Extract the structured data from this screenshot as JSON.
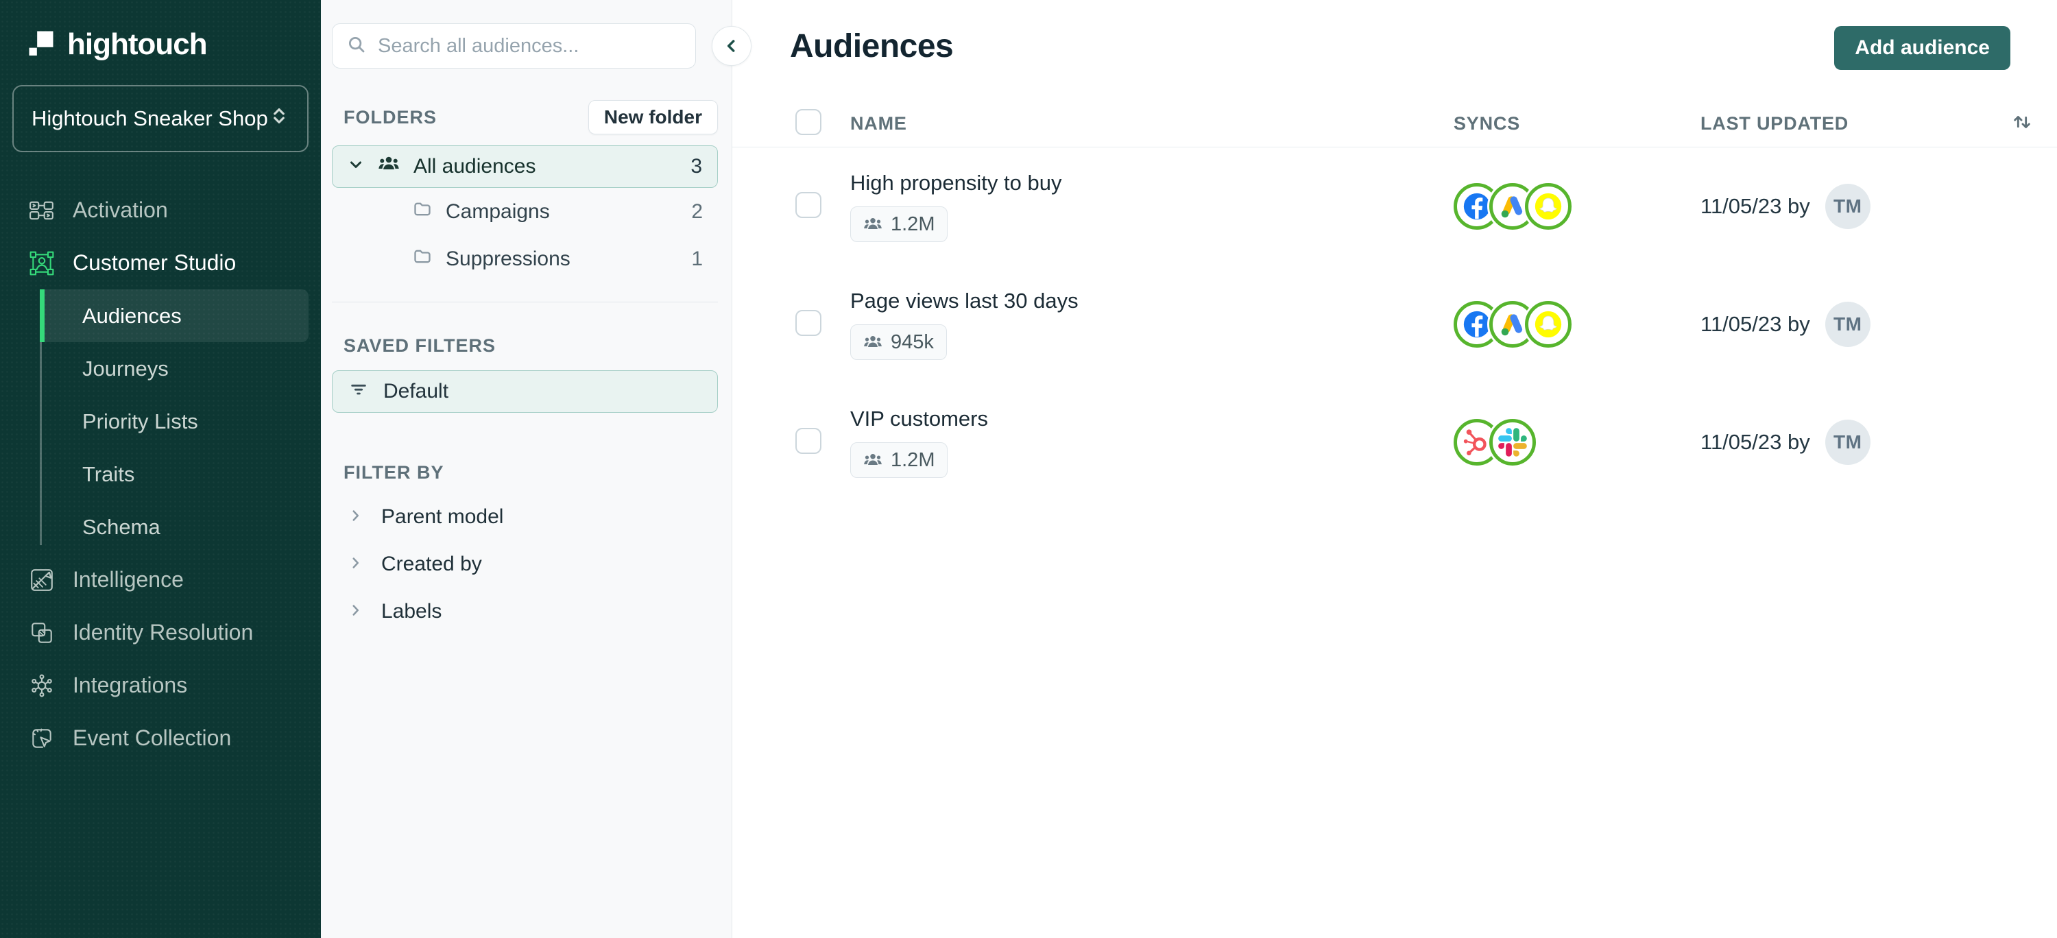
{
  "brand": {
    "logo_text": "hightouch",
    "workspace_name": "Hightouch Sneaker Shop"
  },
  "sidebar": {
    "items": [
      {
        "label": "Activation",
        "icon": "activation-icon"
      },
      {
        "label": "Customer Studio",
        "icon": "customer-studio-icon",
        "active": true,
        "children": [
          {
            "label": "Audiences",
            "active": true
          },
          {
            "label": "Journeys"
          },
          {
            "label": "Priority Lists"
          },
          {
            "label": "Traits"
          },
          {
            "label": "Schema"
          }
        ]
      },
      {
        "label": "Intelligence",
        "icon": "intelligence-icon"
      },
      {
        "label": "Identity Resolution",
        "icon": "identity-resolution-icon"
      },
      {
        "label": "Integrations",
        "icon": "integrations-icon"
      },
      {
        "label": "Event Collection",
        "icon": "event-collection-icon"
      }
    ]
  },
  "panel": {
    "search_placeholder": "Search all audiences...",
    "folders_label": "FOLDERS",
    "new_folder_label": "New folder",
    "folders": [
      {
        "name": "All audiences",
        "count": "3",
        "selected": true,
        "icon": "audience-people-icon"
      },
      {
        "name": "Campaigns",
        "count": "2",
        "icon": "folder-icon"
      },
      {
        "name": "Suppressions",
        "count": "1",
        "icon": "folder-icon"
      }
    ],
    "saved_filters_label": "SAVED FILTERS",
    "saved_filters": [
      {
        "name": "Default",
        "icon": "filter-lines-icon"
      }
    ],
    "filter_by_label": "FILTER BY",
    "filter_by": [
      {
        "label": "Parent model"
      },
      {
        "label": "Created by"
      },
      {
        "label": "Labels"
      }
    ]
  },
  "main": {
    "title": "Audiences",
    "add_button_label": "Add audience",
    "columns": {
      "name": "NAME",
      "syncs": "SYNCS",
      "last_updated": "LAST UPDATED"
    },
    "rows": [
      {
        "name": "High propensity to buy",
        "size": "1.2M",
        "syncs": [
          "facebook",
          "google-ads",
          "snapchat"
        ],
        "updated": "11/05/23 by",
        "avatar": "TM"
      },
      {
        "name": "Page views last 30 days",
        "size": "945k",
        "syncs": [
          "facebook",
          "google-ads",
          "snapchat"
        ],
        "updated": "11/05/23 by",
        "avatar": "TM"
      },
      {
        "name": "VIP customers",
        "size": "1.2M",
        "syncs": [
          "hubspot",
          "slack"
        ],
        "updated": "11/05/23 by",
        "avatar": "TM"
      }
    ]
  },
  "colors": {
    "sidebar_bg": "#0d3733",
    "accent_green": "#35d97a",
    "selection_teal_bg": "#e9f3f1",
    "selection_teal_border": "#a6cfc7",
    "button_teal": "#2e6b68",
    "sync_ring_green": "#57b52d",
    "facebook_blue": "#1877F2",
    "snapchat_yellow": "#FFFC00",
    "hubspot_orange": "#F2545B",
    "slack_blue": "#36C5F0",
    "slack_green": "#2EB67D",
    "slack_yellow": "#ECB22E",
    "slack_red": "#E01E5A"
  }
}
